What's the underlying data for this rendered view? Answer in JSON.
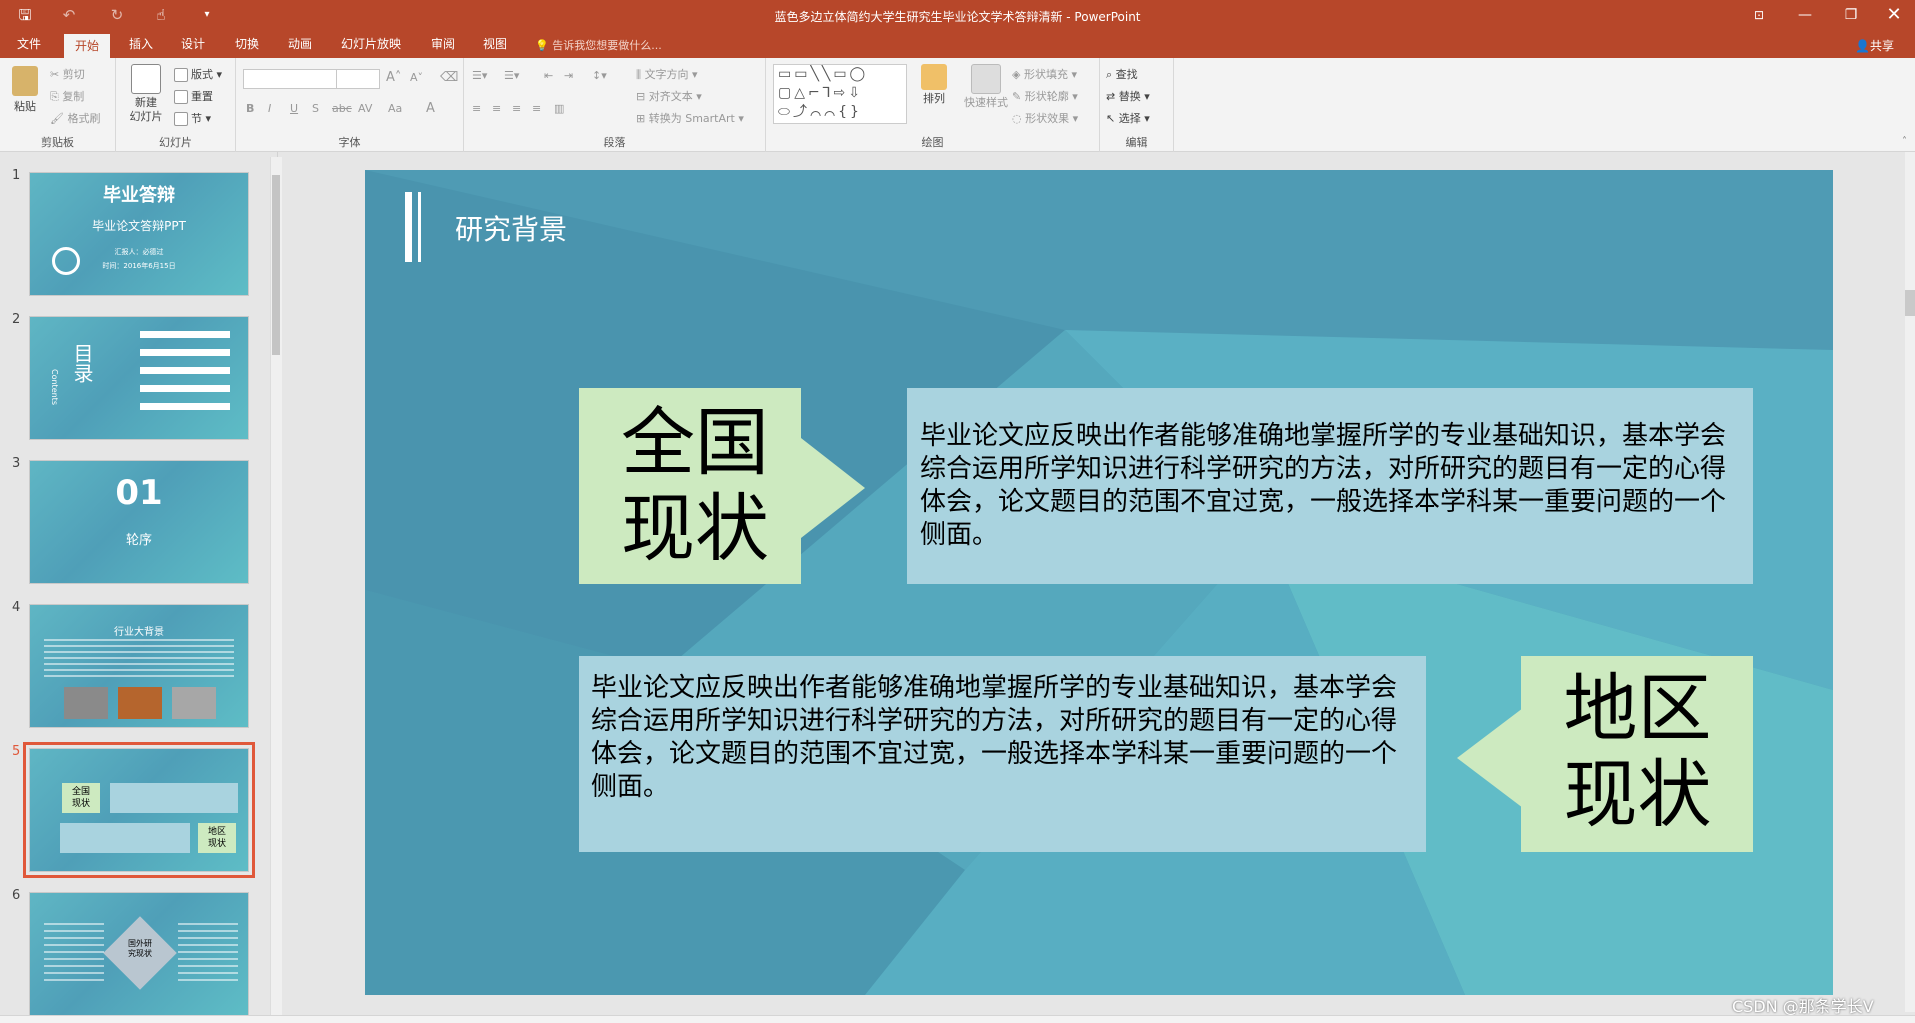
{
  "titlebar": {
    "title": "蓝色多边立体简约大学生研究生毕业论文学术答辩清新 - PowerPoint",
    "qat_icons": [
      "save-icon",
      "undo-icon",
      "redo-icon",
      "touch-mode-icon",
      "customize-icon"
    ],
    "window_buttons": [
      "ribbon-display-icon",
      "minimize-icon",
      "restore-icon",
      "close-icon"
    ]
  },
  "tabs": [
    "文件",
    "开始",
    "插入",
    "设计",
    "切换",
    "动画",
    "幻灯片放映",
    "审阅",
    "视图"
  ],
  "active_tab": "开始",
  "tell_me": "告诉我您想要做什么...",
  "share": "共享",
  "ribbon": {
    "clipboard": {
      "paste": "粘贴",
      "cut": "剪切",
      "copy": "复制",
      "format_painter": "格式刷",
      "label": "剪贴板"
    },
    "slides": {
      "new_slide": "新建\n幻灯片",
      "layout": "版式",
      "reset": "重置",
      "section": "节",
      "label": "幻灯片"
    },
    "font": {
      "label": "字体",
      "bold": "B",
      "italic": "I",
      "underline": "U",
      "shadow": "S",
      "strike": "abc",
      "spacing": "AV",
      "case": "Aa",
      "color": "A",
      "grow": "A",
      "shrink": "A"
    },
    "paragraph": {
      "label": "段落",
      "text_direction": "文字方向",
      "align_text": "对齐文本",
      "smartart": "转换为 SmartArt"
    },
    "drawing": {
      "label": "绘图",
      "arrange": "排列",
      "quick_styles": "快速样式",
      "shape_fill": "形状填充",
      "shape_outline": "形状轮廓",
      "shape_effects": "形状效果"
    },
    "editing": {
      "label": "编辑",
      "find": "查找",
      "replace": "替换",
      "select": "选择"
    }
  },
  "thumbnails": [
    {
      "num": "1",
      "title": "毕业答辩",
      "subtitle": "毕业论文答辩PPT",
      "line1": "汇报人：必德过",
      "line2": "时间：2016年6月15日"
    },
    {
      "num": "2",
      "title": "目录",
      "subtitle": "Contents"
    },
    {
      "num": "3",
      "title": "01",
      "subtitle": "轮序"
    },
    {
      "num": "4",
      "title": "行业大背景"
    },
    {
      "num": "5",
      "left": "全国\n现状",
      "right": "地区\n现状"
    },
    {
      "num": "6",
      "center": "国外研\n究现状"
    }
  ],
  "selected_thumb": "5",
  "slide": {
    "heading": "研究背景",
    "box1_label": "全国\n现状",
    "box1_text": "毕业论文应反映出作者能够准确地掌握所学的专业基础知识，基本学会综合运用所学知识进行科学研究的方法，对所研究的题目有一定的心得体会，论文题目的范围不宜过宽，一般选择本学科某一重要问题的一个侧面。",
    "box2_label": "地区\n现状",
    "box2_text": "毕业论文应反映出作者能够准确地掌握所学的专业基础知识，基本学会综合运用所学知识进行科学研究的方法，对所研究的题目有一定的心得体会，论文题目的范围不宜过宽，一般选择本学科某一重要问题的一个侧面。"
  },
  "watermark": "CSDN @那条学长V",
  "colors": {
    "accent": "#b7472a",
    "slide_bg": "#4d9fb4",
    "label_box": "#cdeac0",
    "text_box": "#a9d3df"
  }
}
